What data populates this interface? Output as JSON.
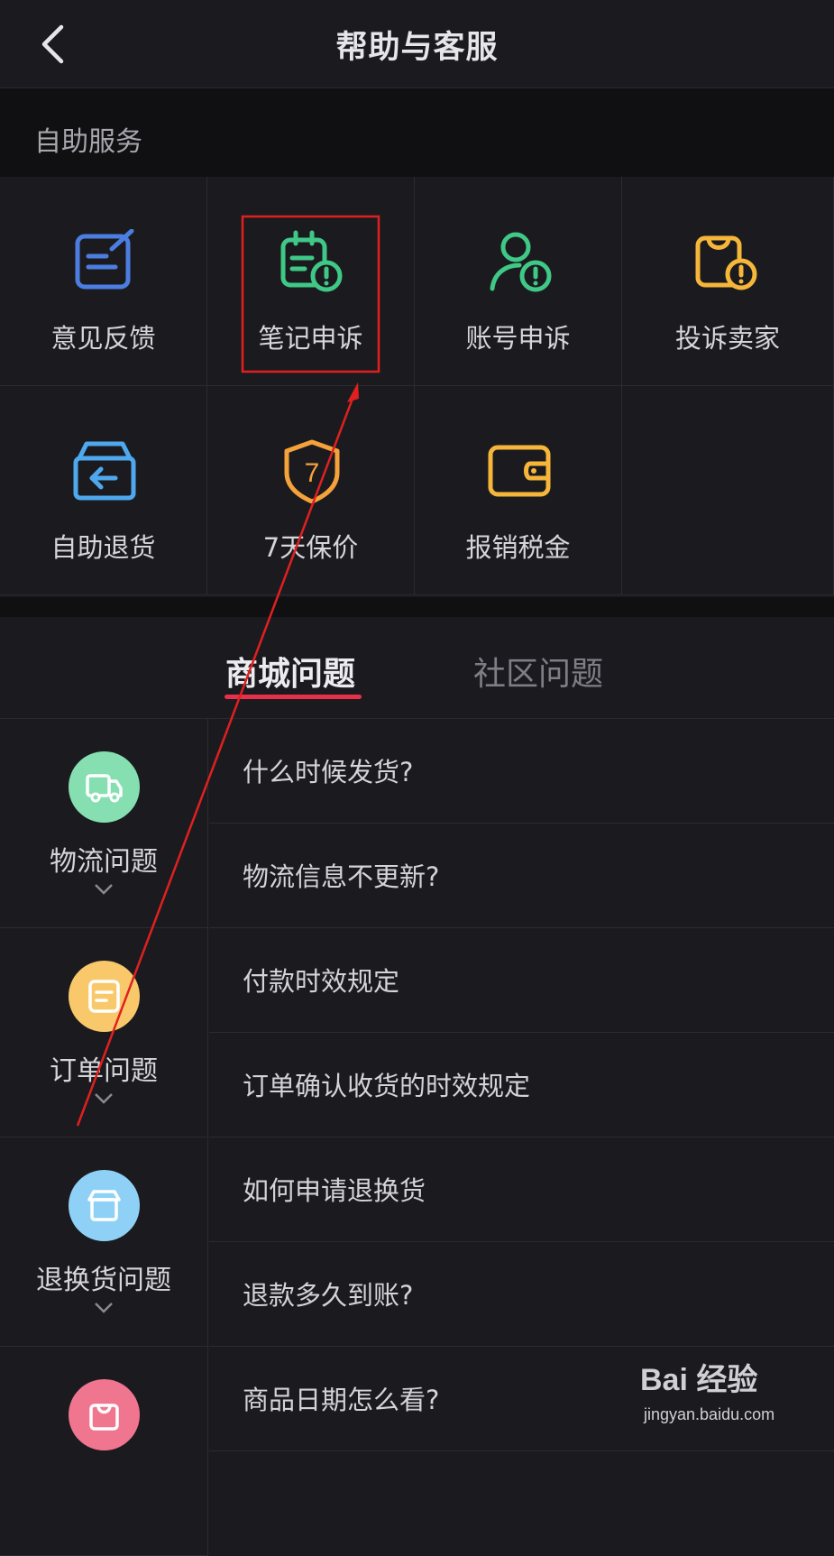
{
  "header": {
    "title": "帮助与客服"
  },
  "self_service": {
    "heading": "自助服务",
    "items": [
      {
        "label": "意见反馈",
        "icon": "feedback-icon",
        "color": "#4b7ee0"
      },
      {
        "label": "笔记申诉",
        "icon": "note-appeal-icon",
        "color": "#3fc886"
      },
      {
        "label": "账号申诉",
        "icon": "account-appeal-icon",
        "color": "#3fc886"
      },
      {
        "label": "投诉卖家",
        "icon": "complain-seller-icon",
        "color": "#f5b63a"
      },
      {
        "label": "自助退货",
        "icon": "return-box-icon",
        "color": "#4fa8ee"
      },
      {
        "label": "7天保价",
        "icon": "price-protect-shield-icon",
        "color": "#f5a23a",
        "badge": "7"
      },
      {
        "label": "报销税金",
        "icon": "wallet-icon",
        "color": "#f5b63a"
      }
    ]
  },
  "tabs": [
    {
      "label": "商城问题",
      "active": true
    },
    {
      "label": "社区问题",
      "active": false
    }
  ],
  "categories": [
    {
      "label": "物流问题",
      "icon": "truck-icon",
      "color": "#85dfb0",
      "questions": [
        "什么时候发货?",
        "物流信息不更新?"
      ]
    },
    {
      "label": "订单问题",
      "icon": "order-doc-icon",
      "color": "#f9c86a",
      "questions": [
        "付款时效规定",
        "订单确认收货的时效规定"
      ]
    },
    {
      "label": "退换货问题",
      "icon": "store-icon",
      "color": "#8fd1f6",
      "questions": [
        "如何申请退换货",
        "退款多久到账?"
      ]
    },
    {
      "label": "",
      "icon": "shopping-bag-icon",
      "color": "#f0758e",
      "questions": [
        "商品日期怎么看?"
      ]
    }
  ],
  "watermark": {
    "brand": "Bai 经验",
    "url": "jingyan.baidu.com"
  },
  "annotation_color": "#e02020"
}
